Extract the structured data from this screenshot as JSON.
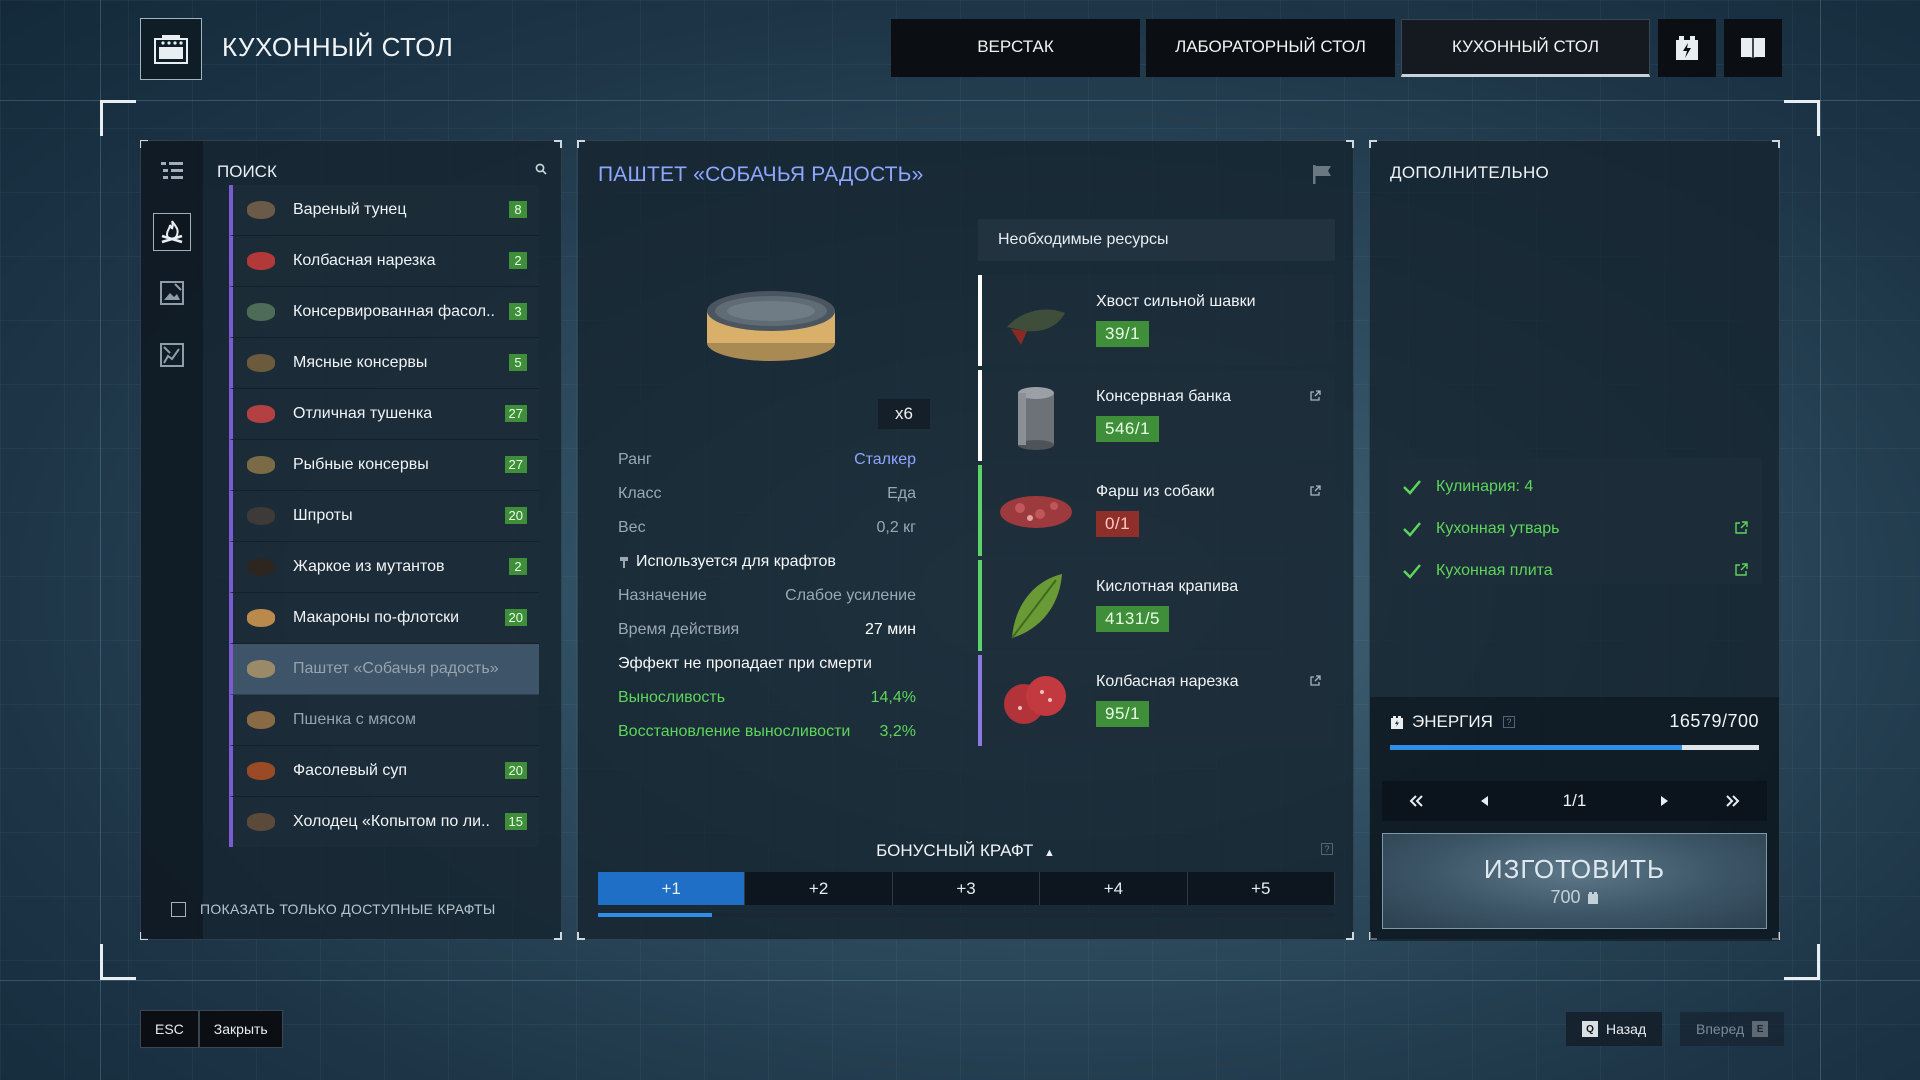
{
  "header": {
    "title": "КУХОННЫЙ СТОЛ",
    "tabs": [
      {
        "label": "ВЕРСТАК",
        "active": false
      },
      {
        "label": "ЛАБОРАТОРНЫЙ СТОЛ",
        "active": false
      },
      {
        "label": "КУХОННЫЙ СТОЛ",
        "active": true
      }
    ],
    "icons": [
      "energy-battery-icon",
      "book-icon"
    ]
  },
  "left": {
    "search_label": "ПОИСК",
    "rail_icons": [
      "campfire-icon",
      "edit-image-icon",
      "edit-chart-icon"
    ],
    "recipes": [
      {
        "name": "Вареный тунец",
        "count": "8",
        "color": "#6b5a48",
        "selected": false,
        "dim": false
      },
      {
        "name": "Колбасная нарезка",
        "count": "2",
        "color": "#b3383a",
        "selected": false,
        "dim": false
      },
      {
        "name": "Консервированная фасол..",
        "count": "3",
        "color": "#4d6b57",
        "selected": false,
        "dim": false
      },
      {
        "name": "Мясные консервы",
        "count": "5",
        "color": "#6c5a3c",
        "selected": false,
        "dim": false
      },
      {
        "name": "Отличная тушенка",
        "count": "27",
        "color": "#b34141",
        "selected": false,
        "dim": false
      },
      {
        "name": "Рыбные консервы",
        "count": "27",
        "color": "#7a6a45",
        "selected": false,
        "dim": false
      },
      {
        "name": "Шпроты",
        "count": "20",
        "color": "#3e3a37",
        "selected": false,
        "dim": false
      },
      {
        "name": "Жаркое из мутантов",
        "count": "2",
        "color": "#2d2520",
        "selected": false,
        "dim": false
      },
      {
        "name": "Макароны по-флотски",
        "count": "20",
        "color": "#b98a4b",
        "selected": false,
        "dim": false
      },
      {
        "name": "Паштет «Собачья радость»",
        "count": "",
        "color": "#9a8a6a",
        "selected": true,
        "dim": true
      },
      {
        "name": "Пшенка с мясом",
        "count": "",
        "color": "#8a6a45",
        "selected": false,
        "dim": true
      },
      {
        "name": "Фасолевый суп",
        "count": "20",
        "color": "#9a4a25",
        "selected": false,
        "dim": false
      },
      {
        "name": "Холодец «Копытом по ли..",
        "count": "15",
        "color": "#5b4a3a",
        "selected": false,
        "dim": false
      }
    ],
    "filter_label": "ПОКАЗАТЬ ТОЛЬКО ДОСТУПНЫЕ КРАФТЫ"
  },
  "center": {
    "title": "ПАШТЕТ «СОБАЧЬЯ РАДОСТЬ»",
    "quantity": "x6",
    "stats": {
      "rank_label": "Ранг",
      "rank_value": "Сталкер",
      "class_label": "Класс",
      "class_value": "Еда",
      "weight_label": "Вес",
      "weight_value": "0,2 кг",
      "used_for": "Используется для крафтов",
      "purpose_label": "Назначение",
      "purpose_value": "Слабое усиление",
      "duration_label": "Время действия",
      "duration_value": "27 мин",
      "death_note": "Эффект не пропадает при смерти",
      "effects": [
        {
          "label": "Выносливость",
          "value": "14,4%"
        },
        {
          "label": "Восстановление выносливости",
          "value": "3,2%"
        }
      ]
    },
    "resources_header": "Необходимые ресурсы",
    "resources": [
      {
        "name": "Хвост сильной шавки",
        "count": "39/1",
        "ok": true,
        "border": "white",
        "link": false,
        "icon": "tail-icon"
      },
      {
        "name": "Консервная банка",
        "count": "546/1",
        "ok": true,
        "border": "white",
        "link": true,
        "icon": "tin-can-icon"
      },
      {
        "name": "Фарш из собаки",
        "count": "0/1",
        "ok": false,
        "border": "green",
        "link": true,
        "icon": "minced-meat-icon"
      },
      {
        "name": "Кислотная крапива",
        "count": "4131/5",
        "ok": true,
        "border": "green",
        "link": false,
        "icon": "nettle-leaf-icon"
      },
      {
        "name": "Колбасная нарезка",
        "count": "95/1",
        "ok": true,
        "border": "purple",
        "link": true,
        "icon": "sausage-slices-icon"
      }
    ],
    "bonus": {
      "title": "БОНУСНЫЙ КРАФТ",
      "help": "?",
      "tabs": [
        "+1",
        "+2",
        "+3",
        "+4",
        "+5"
      ],
      "active_index": 0,
      "progress": 0.155
    }
  },
  "right": {
    "title": "ДОПОЛНИТЕЛЬНО",
    "requirements": [
      {
        "label": "Кулинария: 4",
        "link": false
      },
      {
        "label": "Кухонная утварь",
        "link": true
      },
      {
        "label": "Кухонная плита",
        "link": true
      }
    ],
    "energy_label": "ЭНЕРГИЯ",
    "energy_help": "?",
    "energy_value": "16579/700",
    "energy_fill": 0.79,
    "pager_label": "1/1",
    "craft_label": "ИЗГОТОВИТЬ",
    "craft_cost": "700"
  },
  "footer": {
    "esc_key": "ESC",
    "close_label": "Закрыть",
    "back_key": "Q",
    "back_label": "Назад",
    "forward_label": "Вперед",
    "forward_key": "E"
  },
  "colors": {
    "accent_blue": "#2e8ee8",
    "title_blue": "#8fa6ff",
    "ok_green": "#3f8f3a",
    "effect_green": "#5dd55a",
    "missing_red": "#8f2f2a",
    "list_border_purple": "#7a5bd1"
  }
}
